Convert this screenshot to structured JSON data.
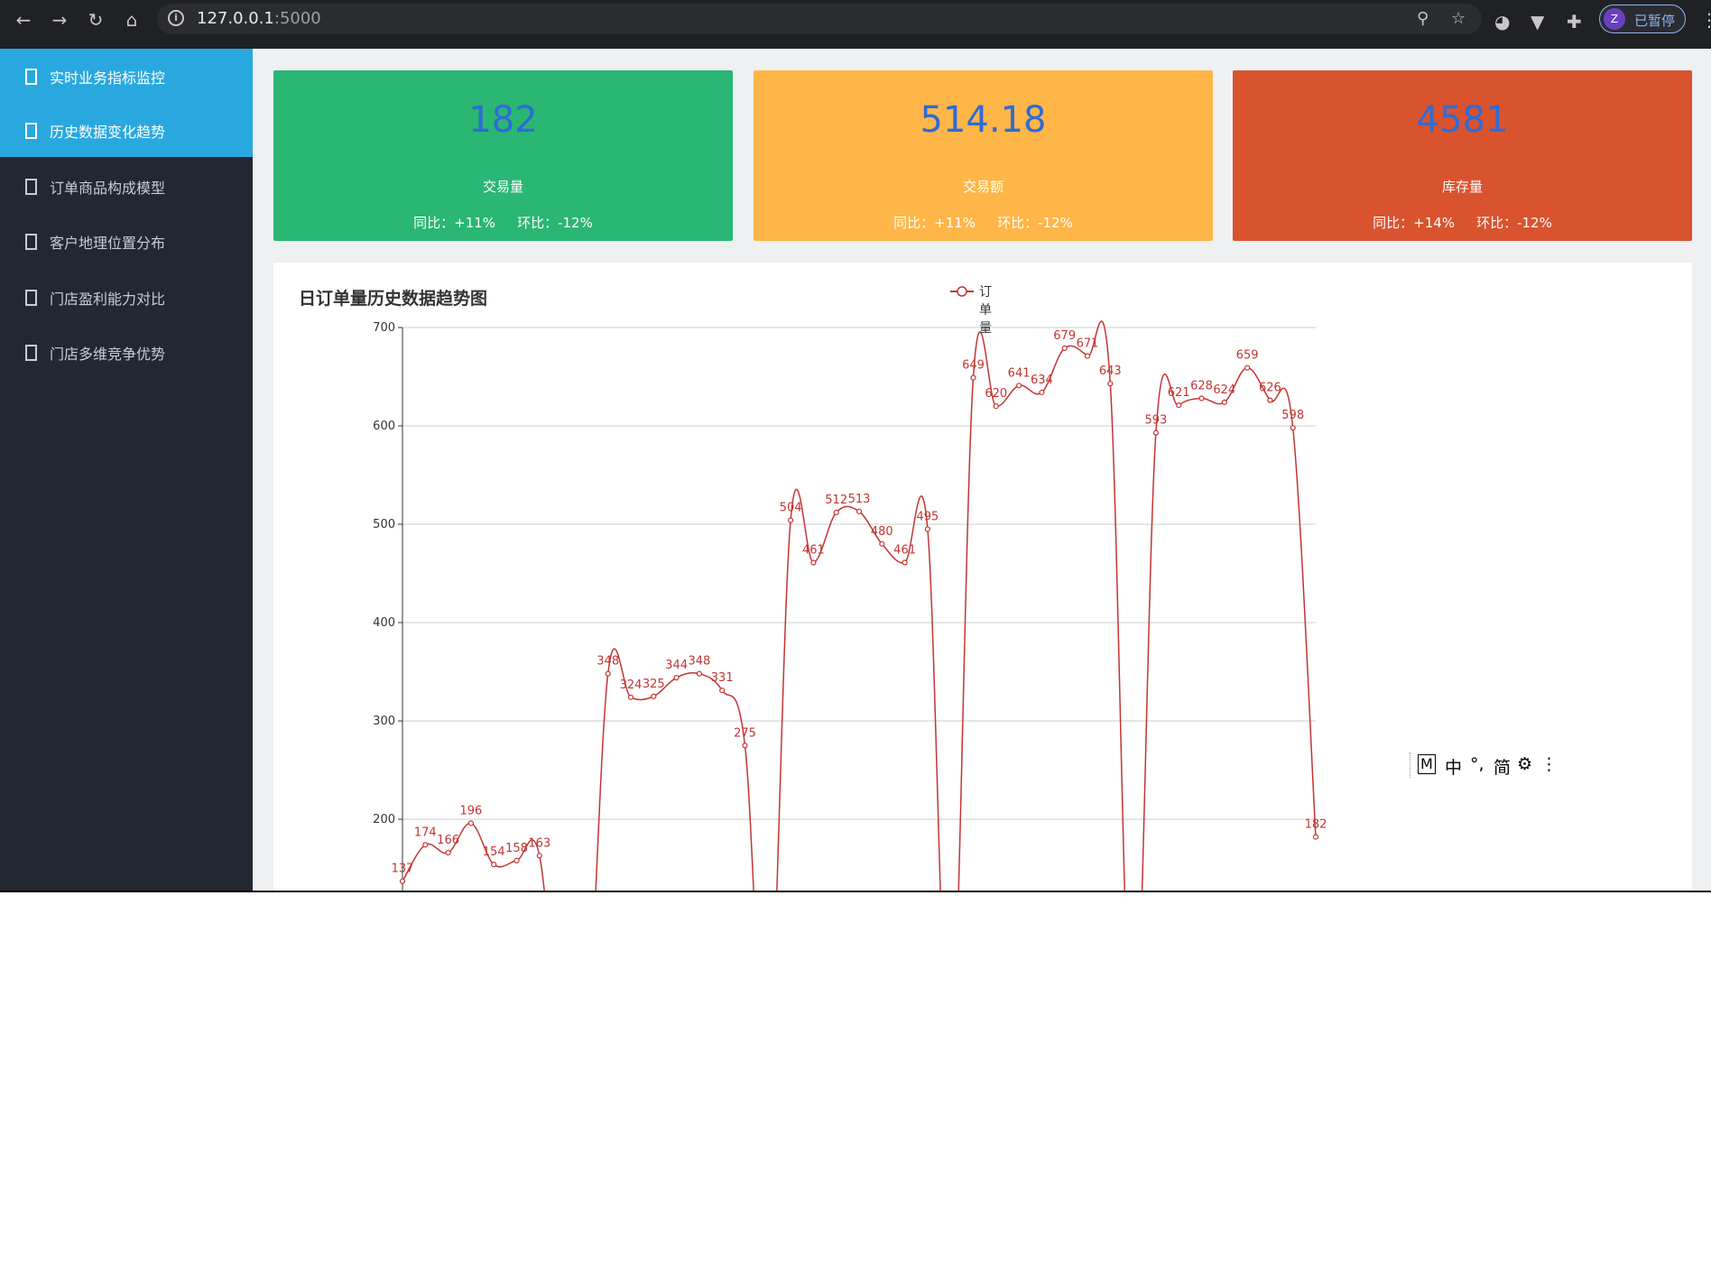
{
  "browser": {
    "url_host": "127.0.0.1",
    "url_port": ":5000",
    "profile_initial": "Z",
    "profile_status": "已暂停"
  },
  "sidebar": {
    "items": [
      {
        "label": "实时业务指标监控",
        "active": true
      },
      {
        "label": "历史数据变化趋势",
        "active": true
      },
      {
        "label": "订单商品构成模型",
        "active": false
      },
      {
        "label": "客户地理位置分布",
        "active": false
      },
      {
        "label": "门店盈利能力对比",
        "active": false
      },
      {
        "label": "门店多维竞争优势",
        "active": false
      }
    ]
  },
  "cards": [
    {
      "value": "182",
      "name": "交易量",
      "yoy": "同比：+11%",
      "mom": "环比：-12%",
      "color": "#2ab673"
    },
    {
      "value": "514.18",
      "name": "交易额",
      "yoy": "同比：+11%",
      "mom": "环比：-12%",
      "color": "#ffb648"
    },
    {
      "value": "4581",
      "name": "库存量",
      "yoy": "同比：+14%",
      "mom": "环比：-12%",
      "color": "#d9532f"
    }
  ],
  "chart": {
    "title": "日订单量历史数据趋势图",
    "legend": "订单量"
  },
  "ime_toolbar": {
    "mode": "M",
    "lang": "中",
    "punct": "°,",
    "charset": "简",
    "gear": "⚙",
    "more": "⋮"
  },
  "chart_data": {
    "type": "line",
    "smooth": true,
    "color": "#c23531",
    "series": [
      {
        "name": "订单量",
        "values": [
          137,
          174,
          166,
          196,
          154,
          158,
          163,
          null,
          null,
          348,
          324,
          325,
          344,
          348,
          331,
          275,
          null,
          504,
          461,
          512,
          513,
          480,
          461,
          495,
          null,
          649,
          620,
          641,
          634,
          679,
          671,
          643,
          null,
          593,
          621,
          628,
          624,
          659,
          626,
          598,
          182
        ]
      }
    ],
    "y_ticks": [
      200,
      300,
      400,
      500,
      600,
      700
    ],
    "ylim": [
      100,
      700
    ],
    "grid": true
  }
}
